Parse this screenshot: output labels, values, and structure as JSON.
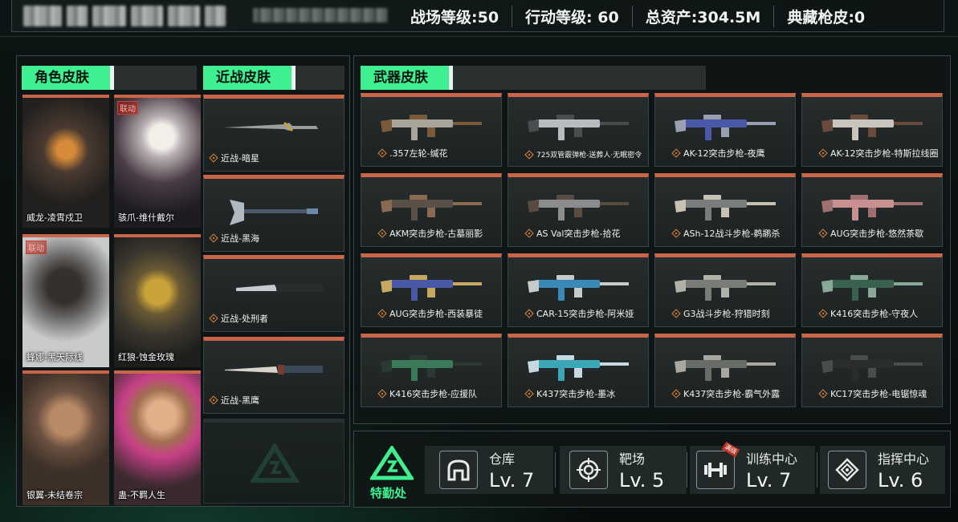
{
  "header": {
    "battlefield_level": "战场等级:50",
    "operation_level": "行动等级: 60",
    "total_assets": "总资产:304.5M",
    "collection_skins": "典藏枪皮:0"
  },
  "sections": {
    "character_skins": "角色皮肤",
    "melee_skins": "近战皮肤",
    "weapon_skins": "武器皮肤"
  },
  "characters": [
    {
      "label": "威龙-凌霄戍卫",
      "badge": ""
    },
    {
      "label": "骇爪-维什戴尔",
      "badge": "联动"
    },
    {
      "label": "蜂娜-黑天际线",
      "badge": "联动"
    },
    {
      "label": "红狼-蚀金玫瑰",
      "badge": ""
    },
    {
      "label": "银翼-未结卷宗",
      "badge": ""
    },
    {
      "label": "蛊-不羁人生",
      "badge": ""
    }
  ],
  "melee": [
    {
      "label": "近战-暗星"
    },
    {
      "label": "近战-黑海"
    },
    {
      "label": "近战-处刑者"
    },
    {
      "label": "近战-黑鹰"
    }
  ],
  "weapons": [
    {
      "label": ".357左轮-缄花"
    },
    {
      "label": "725双管霰弹枪-送葬人·无眠密令"
    },
    {
      "label": "AK-12突击步枪-夜鹰"
    },
    {
      "label": "AK-12突击步枪-特斯拉线圈"
    },
    {
      "label": "AKM突击步枪-古墓丽影"
    },
    {
      "label": "AS Val突击步枪-拾花"
    },
    {
      "label": "ASh-12战斗步枪-鹈鹕杀"
    },
    {
      "label": "AUG突击步枪-悠然茶歇"
    },
    {
      "label": "AUG突击步枪-西装暴徒"
    },
    {
      "label": "CAR-15突击步枪-阿米娅"
    },
    {
      "label": "G3战斗步枪-狩猎时刻"
    },
    {
      "label": "K416突击步枪-守夜人"
    },
    {
      "label": "K416突击步枪-应援队"
    },
    {
      "label": "K437突击步枪-墨冰"
    },
    {
      "label": "K437突击步枪-霸气外露"
    },
    {
      "label": "KC17突击步枪-电锯惊魂"
    }
  ],
  "bottom": {
    "logo_label": "特勤处",
    "facilities": [
      {
        "name": "仓库",
        "level": "Lv. 7",
        "icon": "warehouse-icon",
        "tag": ""
      },
      {
        "name": "靶场",
        "level": "Lv. 5",
        "icon": "target-icon",
        "tag": ""
      },
      {
        "name": "训练中心",
        "level": "Lv. 7",
        "icon": "dumbbell-icon",
        "tag": "满级"
      },
      {
        "name": "指挥中心",
        "level": "Lv. 6",
        "icon": "command-icon",
        "tag": ""
      }
    ]
  },
  "colors": {
    "accent_green": "#3ef08f",
    "card_top_orange": "#c96548",
    "label_diamond": "#e4863e"
  }
}
